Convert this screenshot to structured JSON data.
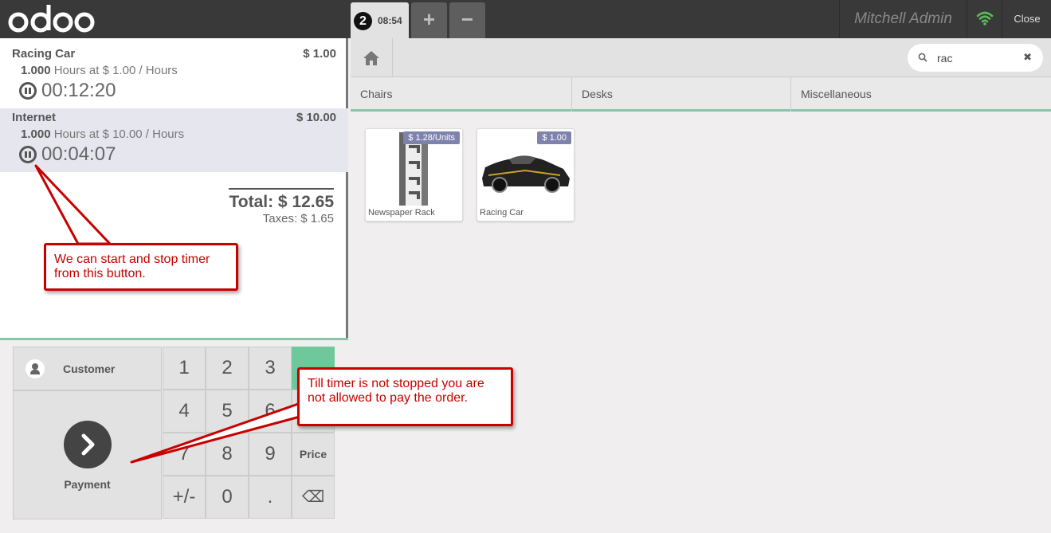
{
  "topbar": {
    "logo": "odoo",
    "order_tab": {
      "number": "2",
      "time": "08:54"
    },
    "add_label": "+",
    "remove_label": "−",
    "user": "Mitchell Admin",
    "close_label": "Close"
  },
  "order": {
    "lines": [
      {
        "name": "Racing Car",
        "price": "$ 1.00",
        "qty": "1.000",
        "unit_text": "Hours at $ 1.00 / Hours",
        "timer": "00:12:20"
      },
      {
        "name": "Internet",
        "price": "$ 10.00",
        "qty": "1.000",
        "unit_text": "Hours at $ 10.00 / Hours",
        "timer": "00:04:07"
      }
    ],
    "total": "Total: $ 12.65",
    "taxes": "Taxes: $ 1.65"
  },
  "actions": {
    "customer_label": "Customer",
    "payment_label": "Payment"
  },
  "numpad": {
    "keys": [
      "1",
      "2",
      "3",
      "4",
      "5",
      "6",
      "7",
      "8",
      "9",
      "+/-",
      "0",
      "."
    ],
    "price_label": "Price",
    "backspace": "⌫"
  },
  "search": {
    "value": "rac",
    "clear": "✖"
  },
  "categories": [
    "Chairs",
    "Desks",
    "Miscellaneous"
  ],
  "products": [
    {
      "name": "Newspaper Rack",
      "price": "$ 1.28/Units"
    },
    {
      "name": "Racing Car",
      "price": "$ 1.00"
    }
  ],
  "annotations": {
    "timer_note": "We can start and stop timer from this button.",
    "payment_note": "Till timer is not stopped you are not allowed to pay the order."
  },
  "colors": {
    "accent": "#6ec89b",
    "tag": "#7f82ac",
    "callout": "#c80000",
    "topbar": "#393939"
  }
}
